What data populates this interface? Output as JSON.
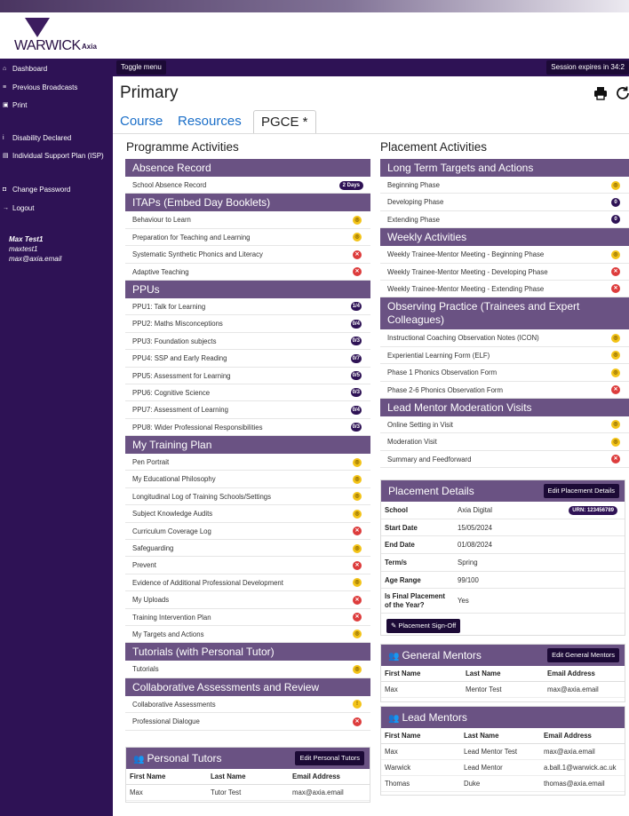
{
  "brand": {
    "name": "WARWICK",
    "sub": "Axia"
  },
  "sidebar": {
    "items": [
      {
        "label": "Dashboard",
        "icon": "home-icon"
      },
      {
        "label": "Previous Broadcasts",
        "icon": "broadcast-icon"
      },
      {
        "label": "Print",
        "icon": "print-icon"
      },
      {
        "label": "Disability Declared",
        "icon": "info-icon"
      },
      {
        "label": "Individual Support Plan (ISP)",
        "icon": "document-icon"
      },
      {
        "label": "Change Password",
        "icon": "lock-icon"
      },
      {
        "label": "Logout",
        "icon": "logout-icon"
      }
    ],
    "user": {
      "name": "Max Test1",
      "username": "maxtest1",
      "email": "max@axia.email"
    }
  },
  "topbar": {
    "toggle": "Toggle menu",
    "session": "Session expires in 34:2"
  },
  "page_title": "Primary",
  "tabs": [
    {
      "label": "Course"
    },
    {
      "label": "Resources"
    },
    {
      "label": "PGCE *"
    }
  ],
  "programme": {
    "title": "Programme Activities",
    "sections": [
      {
        "header": "Absence Record",
        "rows": [
          {
            "label": "School Absence Record",
            "badge": "2 Days",
            "kind": "pill"
          }
        ]
      },
      {
        "header": "ITAPs (Embed Day Booklets)",
        "rows": [
          {
            "label": "Behaviour to Learn",
            "badge": "◎",
            "kind": "y"
          },
          {
            "label": "Preparation for Teaching and Learning",
            "badge": "◎",
            "kind": "y"
          },
          {
            "label": "Systematic Synthetic Phonics and Literacy",
            "badge": "✕",
            "kind": "r"
          },
          {
            "label": "Adaptive Teaching",
            "badge": "✕",
            "kind": "r"
          }
        ]
      },
      {
        "header": "PPUs",
        "rows": [
          {
            "label": "PPU1: Talk for Learning",
            "badge": "1/4",
            "kind": "d"
          },
          {
            "label": "PPU2: Maths Misconceptions",
            "badge": "0/4",
            "kind": "d"
          },
          {
            "label": "PPU3: Foundation subjects",
            "badge": "0/3",
            "kind": "d"
          },
          {
            "label": "PPU4: SSP and Early Reading",
            "badge": "0/7",
            "kind": "d"
          },
          {
            "label": "PPU5: Assessment for Learning",
            "badge": "0/5",
            "kind": "d"
          },
          {
            "label": "PPU6: Cognitive Science",
            "badge": "0/3",
            "kind": "d"
          },
          {
            "label": "PPU7: Assessment of Learning",
            "badge": "0/4",
            "kind": "d"
          },
          {
            "label": "PPU8: Wider Professional Responsibilities",
            "badge": "0/3",
            "kind": "d"
          }
        ]
      },
      {
        "header": "My Training Plan",
        "rows": [
          {
            "label": "Pen Portrait",
            "badge": "◎",
            "kind": "y"
          },
          {
            "label": "My Educational Philosophy",
            "badge": "◎",
            "kind": "y"
          },
          {
            "label": "Longitudinal Log of Training Schools/Settings",
            "badge": "◎",
            "kind": "y"
          },
          {
            "label": "Subject Knowledge Audits",
            "badge": "◎",
            "kind": "y"
          },
          {
            "label": "Curriculum Coverage Log",
            "badge": "✕",
            "kind": "r"
          },
          {
            "label": "Safeguarding",
            "badge": "◎",
            "kind": "y"
          },
          {
            "label": "Prevent",
            "badge": "✕",
            "kind": "r"
          },
          {
            "label": "Evidence of Additional Professional Development",
            "badge": "◎",
            "kind": "y"
          },
          {
            "label": "My Uploads",
            "badge": "✕",
            "kind": "r"
          },
          {
            "label": "Training Intervention Plan",
            "badge": "✕",
            "kind": "r"
          },
          {
            "label": "My Targets and Actions",
            "badge": "◎",
            "kind": "y"
          }
        ]
      },
      {
        "header": "Tutorials (with Personal Tutor)",
        "rows": [
          {
            "label": "Tutorials",
            "badge": "◎",
            "kind": "y"
          }
        ]
      },
      {
        "header": "Collaborative Assessments and Review",
        "rows": [
          {
            "label": "Collaborative Assessments",
            "badge": "!",
            "kind": "y"
          },
          {
            "label": "Professional Dialogue",
            "badge": "✕",
            "kind": "r"
          }
        ]
      }
    ]
  },
  "personal_tutors": {
    "title": "Personal Tutors",
    "button": "Edit Personal Tutors",
    "columns": [
      "First Name",
      "Last Name",
      "Email Address"
    ],
    "rows": [
      [
        "Max",
        "Tutor Test",
        "max@axia.email"
      ]
    ]
  },
  "placement": {
    "title": "Placement Activities",
    "sections": [
      {
        "header": "Long Term Targets and Actions",
        "rows": [
          {
            "label": "Beginning Phase",
            "badge": "◎",
            "kind": "y"
          },
          {
            "label": "Developing Phase",
            "badge": "0",
            "kind": "d"
          },
          {
            "label": "Extending Phase",
            "badge": "0",
            "kind": "d"
          }
        ]
      },
      {
        "header": "Weekly Activities",
        "rows": [
          {
            "label": "Weekly Trainee-Mentor Meeting - Beginning Phase",
            "badge": "◎",
            "kind": "y"
          },
          {
            "label": "Weekly Trainee-Mentor Meeting - Developing Phase",
            "badge": "✕",
            "kind": "r"
          },
          {
            "label": "Weekly Trainee-Mentor Meeting - Extending Phase",
            "badge": "✕",
            "kind": "r"
          }
        ]
      },
      {
        "header": "Observing Practice (Trainees and Expert Colleagues)",
        "tall": true,
        "rows": [
          {
            "label": "Instructional Coaching Observation Notes (ICON)",
            "badge": "◎",
            "kind": "y"
          },
          {
            "label": "Experiential Learning Form (ELF)",
            "badge": "◎",
            "kind": "y"
          },
          {
            "label": "Phase 1 Phonics Observation Form",
            "badge": "◎",
            "kind": "y"
          },
          {
            "label": "Phase 2-6 Phonics Observation Form",
            "badge": "✕",
            "kind": "r"
          }
        ]
      },
      {
        "header": "Lead Mentor Moderation Visits",
        "rows": [
          {
            "label": "Online Setting in Visit",
            "badge": "◎",
            "kind": "y"
          },
          {
            "label": "Moderation Visit",
            "badge": "◎",
            "kind": "y"
          },
          {
            "label": "Summary and Feedforward",
            "badge": "✕",
            "kind": "r"
          }
        ]
      }
    ]
  },
  "placement_details": {
    "title": "Placement Details",
    "button": "Edit Placement Details",
    "urn": "URN: 123456789",
    "rows": [
      {
        "k": "School",
        "v": "Axia Digital"
      },
      {
        "k": "Start Date",
        "v": "15/05/2024"
      },
      {
        "k": "End Date",
        "v": "01/08/2024"
      },
      {
        "k": "Term/s",
        "v": "Spring"
      },
      {
        "k": "Age Range",
        "v": "99/100"
      },
      {
        "k": "Is Final Placement of the Year?",
        "v": "Yes"
      }
    ],
    "signoff": "Placement Sign-Off"
  },
  "general_mentors": {
    "title": "General Mentors",
    "button": "Edit General Mentors",
    "columns": [
      "First Name",
      "Last Name",
      "Email Address"
    ],
    "rows": [
      [
        "Max",
        "Mentor Test",
        "max@axia.email"
      ]
    ]
  },
  "lead_mentors": {
    "title": "Lead Mentors",
    "columns": [
      "First Name",
      "Last Name",
      "Email Address"
    ],
    "rows": [
      [
        "Max",
        "Lead Mentor Test",
        "max@axia.email"
      ],
      [
        "Warwick",
        "Lead Mentor",
        "a.ball.1@warwick.ac.uk"
      ],
      [
        "Thomas",
        "Duke",
        "thomas@axia.email"
      ]
    ]
  },
  "colors": {
    "sidebar": "#2e1255",
    "header": "#6a5283",
    "link": "#1a6ec8",
    "yellow": "#f3c318",
    "red": "#dd3c3c"
  }
}
